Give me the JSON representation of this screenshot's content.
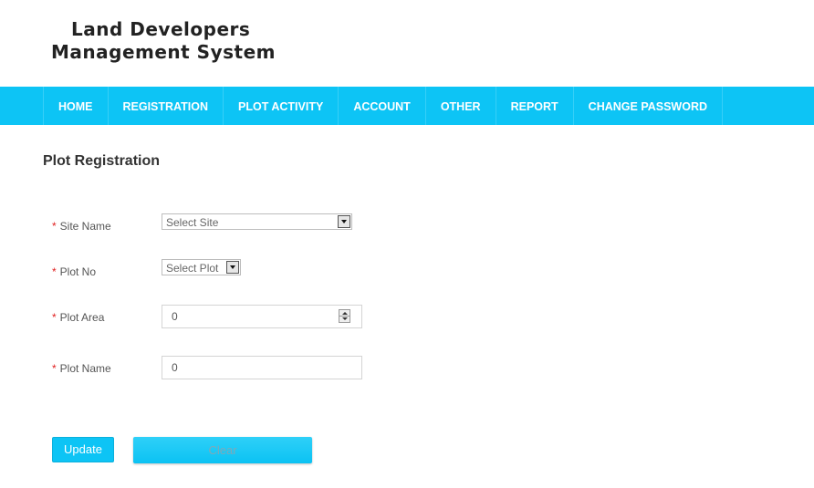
{
  "app": {
    "title_line1": "Land Developers",
    "title_line2": "Management System"
  },
  "nav": {
    "items": [
      {
        "label": "HOME"
      },
      {
        "label": "REGISTRATION"
      },
      {
        "label": "PLOT ACTIVITY"
      },
      {
        "label": "ACCOUNT"
      },
      {
        "label": "OTHER"
      },
      {
        "label": "REPORT"
      },
      {
        "label": "CHANGE PASSWORD"
      }
    ]
  },
  "form": {
    "title": "Plot Registration",
    "required_marker": "*",
    "site_name": {
      "label": "Site Name",
      "value": "Select Site"
    },
    "plot_no": {
      "label": "Plot No",
      "value": "Select Plot"
    },
    "plot_area": {
      "label": "Plot Area",
      "value": "0"
    },
    "plot_name": {
      "label": "Plot Name",
      "value": "0"
    }
  },
  "buttons": {
    "update": "Update",
    "clear": "Clear"
  },
  "colors": {
    "accent": "#0dc4f5",
    "required": "#e02020"
  }
}
